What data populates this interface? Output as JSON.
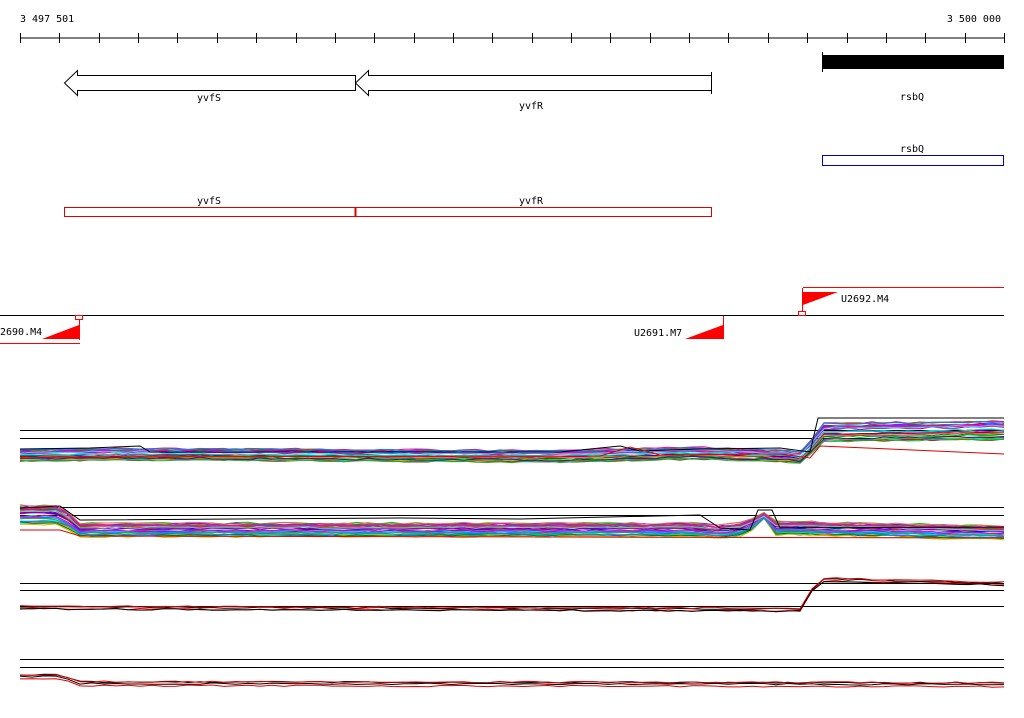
{
  "ruler": {
    "start_label": "3 497 501",
    "end_label": "3 500 000"
  },
  "genes": {
    "yvfS": "yvfS",
    "yvfR": "yvfR",
    "rsbQ": "rsbQ"
  },
  "markers": {
    "left": "2690.M4",
    "middle": "U2691.M7",
    "right": "U2692.M4"
  },
  "colors": {
    "gene_arrow": "#000000",
    "cds_outline": "#e00000",
    "transcript_outline": "#0000c0",
    "marker": "#ff0000"
  },
  "tracks": [
    {
      "name": "expression-track-1",
      "series_count": 30
    },
    {
      "name": "expression-track-2",
      "series_count": 30
    },
    {
      "name": "expression-track-3",
      "series_count": 4
    },
    {
      "name": "expression-track-4",
      "series_count": 4
    }
  ]
}
